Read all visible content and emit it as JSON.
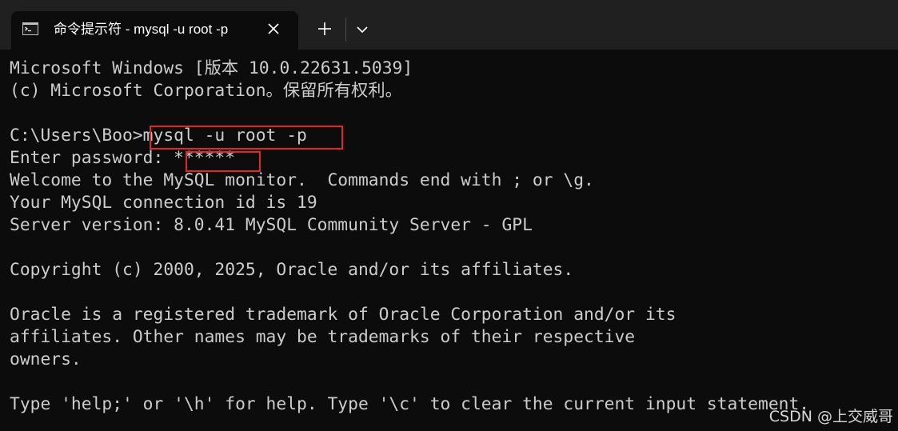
{
  "window": {
    "tab_title": "命令提示符 - mysql  -u root -p",
    "tab_icon": "cmd-icon",
    "close_icon": "close-icon",
    "new_tab_icon": "plus-icon",
    "dropdown_icon": "chevron-down-icon"
  },
  "terminal": {
    "lines": [
      "Microsoft Windows [版本 10.0.22631.5039]",
      "(c) Microsoft Corporation。保留所有权利。",
      "",
      "C:\\Users\\Boo>mysql -u root -p",
      "Enter password: ******",
      "Welcome to the MySQL monitor.  Commands end with ; or \\g.",
      "Your MySQL connection id is 19",
      "Server version: 8.0.41 MySQL Community Server - GPL",
      "",
      "Copyright (c) 2000, 2025, Oracle and/or its affiliates.",
      "",
      "Oracle is a registered trademark of Oracle Corporation and/or its",
      "affiliates. Other names may be trademarks of their respective",
      "owners.",
      "",
      "Type 'help;' or '\\h' for help. Type '\\c' to clear the current input statement."
    ]
  },
  "watermark": "CSDN @上交威哥"
}
